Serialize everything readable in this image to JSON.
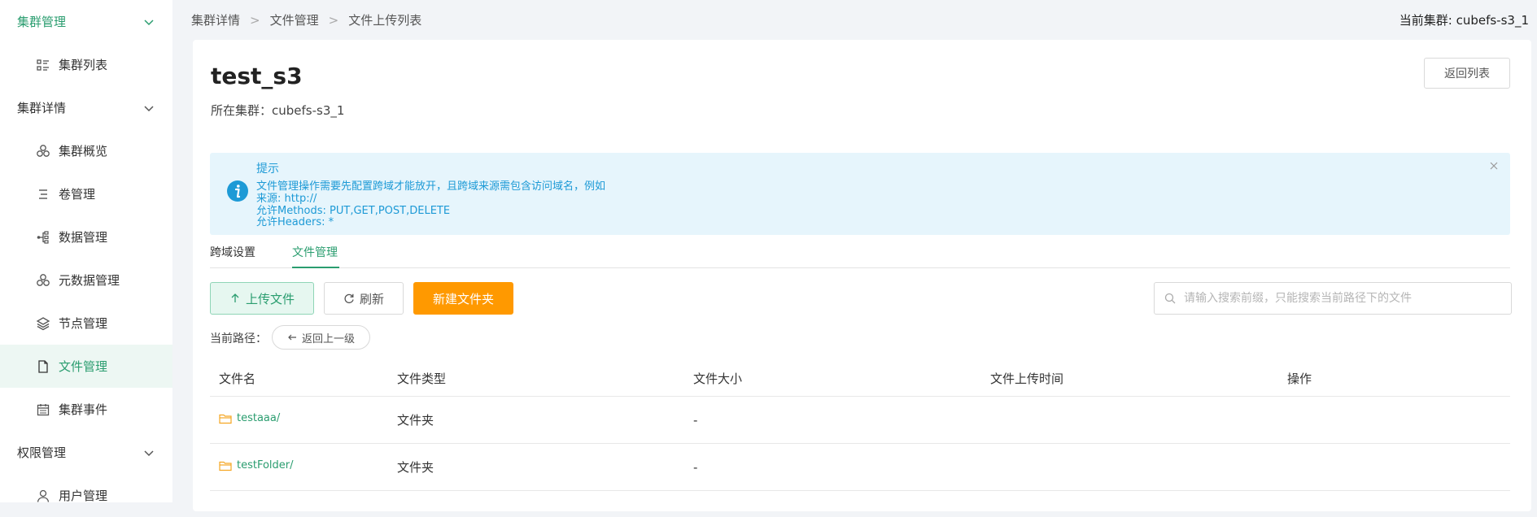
{
  "sidebar": {
    "group_cluster": "集群管理",
    "cluster_list": "集群列表",
    "group_cluster_detail": "集群详情",
    "overview": "集群概览",
    "volume": "卷管理",
    "data": "数据管理",
    "metadata": "元数据管理",
    "node": "节点管理",
    "file": "文件管理",
    "events": "集群事件",
    "group_permission": "权限管理",
    "user": "用户管理"
  },
  "breadcrumb": [
    "集群详情",
    "文件管理",
    "文件上传列表"
  ],
  "current_cluster_label": "当前集群: cubefs-s3_1",
  "page": {
    "title": "test_s3",
    "cluster_line": "所在集群：cubefs-s3_1",
    "back_list": "返回列表"
  },
  "alert": {
    "title": "提示",
    "lines": [
      "文件管理操作需要先配置跨域才能放开，且跨域来源需包含访问域名，例如",
      "来源: http://",
      "允许Methods: PUT,GET,POST,DELETE",
      "允许Headers: *"
    ]
  },
  "tabs": [
    "跨域设置",
    "文件管理"
  ],
  "toolbar": {
    "upload": "上传文件",
    "refresh": "刷新",
    "new_folder": "新建文件夹",
    "search_placeholder": "请输入搜索前缀，只能搜索当前路径下的文件"
  },
  "path": {
    "label": "当前路径：",
    "back": "返回上一级"
  },
  "table": {
    "headers": [
      "文件名",
      "文件类型",
      "文件大小",
      "文件上传时间",
      "操作"
    ],
    "rows": [
      {
        "name": "testaaa/",
        "type": "文件夹",
        "size": "-",
        "time": "",
        "ops": ""
      },
      {
        "name": "testFolder/",
        "type": "文件夹",
        "size": "-",
        "time": "",
        "ops": ""
      }
    ]
  },
  "colors": {
    "accent": "#2a9d6f",
    "primary_action": "#ff9900",
    "info": "#1d9ad6",
    "alert_bg": "#e6f5fc"
  }
}
